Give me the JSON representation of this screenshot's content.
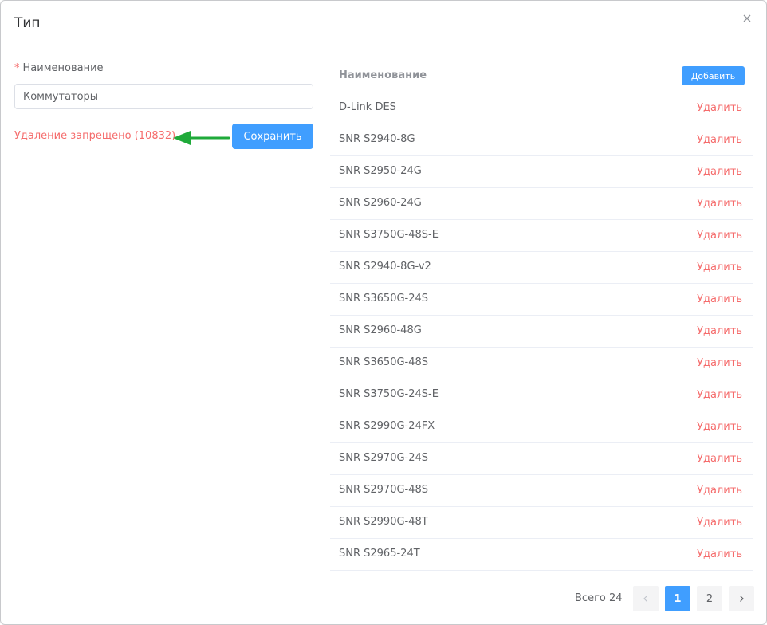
{
  "dialog": {
    "title": "Тип"
  },
  "form": {
    "required_mark": "*",
    "name_label": "Наименование",
    "name_value": "Коммутаторы",
    "error_text": "Удаление запрещено (10832)",
    "save_label": "Сохранить"
  },
  "table": {
    "header_name": "Наименование",
    "add_label": "Добавить",
    "delete_label": "Удалить",
    "rows": [
      "D-Link DES",
      "SNR S2940-8G",
      "SNR S2950-24G",
      "SNR S2960-24G",
      "SNR S3750G-48S-E",
      "SNR S2940-8G-v2",
      "SNR S3650G-24S",
      "SNR S2960-48G",
      "SNR S3650G-48S",
      "SNR S3750G-24S-E",
      "SNR S2990G-24FX",
      "SNR S2970G-24S",
      "SNR S2970G-48S",
      "SNR S2990G-48T",
      "SNR S2965-24T"
    ]
  },
  "pagination": {
    "total_text": "Всего 24",
    "pages": [
      "1",
      "2"
    ],
    "current_page": "1"
  },
  "colors": {
    "primary": "#409eff",
    "danger": "#f56c6c",
    "arrow": "#1faa3a"
  }
}
